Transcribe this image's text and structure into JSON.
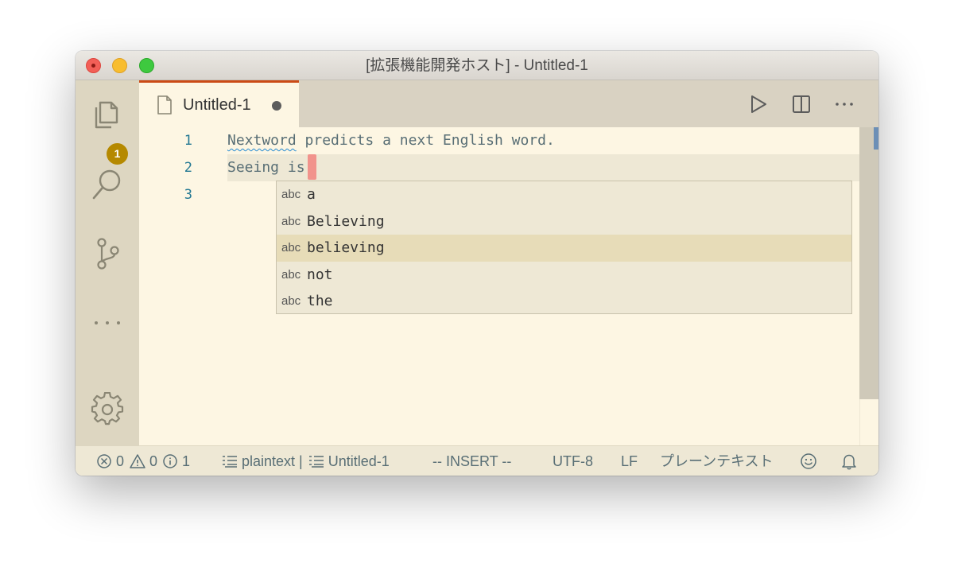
{
  "window": {
    "title": "[拡張機能開発ホスト] - Untitled-1"
  },
  "activity_bar": {
    "items": [
      {
        "name": "explorer",
        "icon": "files-icon",
        "badge": "1"
      },
      {
        "name": "search",
        "icon": "search-icon"
      },
      {
        "name": "source-control",
        "icon": "git-branch-icon"
      },
      {
        "name": "more",
        "icon": "more-horizontal-icon"
      },
      {
        "name": "manage",
        "icon": "gear-icon"
      }
    ]
  },
  "tabs": [
    {
      "label": "Untitled-1",
      "icon": "file-icon",
      "dirty": true
    }
  ],
  "tab_actions": [
    {
      "icon": "run-icon"
    },
    {
      "icon": "split-editor-icon"
    },
    {
      "icon": "more-actions-icon"
    }
  ],
  "editor": {
    "lines": [
      {
        "number": "1",
        "prefix": "Nextword",
        "rest": " predicts a next English word."
      },
      {
        "number": "2",
        "text": "Seeing is"
      },
      {
        "number": "3",
        "text": ""
      }
    ]
  },
  "suggest_widget": {
    "items": [
      {
        "kind": "abc",
        "label": "a",
        "selected": false
      },
      {
        "kind": "abc",
        "label": "Believing",
        "selected": false
      },
      {
        "kind": "abc",
        "label": "believing",
        "selected": true
      },
      {
        "kind": "abc",
        "label": "not",
        "selected": false
      },
      {
        "kind": "abc",
        "label": "the",
        "selected": false
      }
    ]
  },
  "status_bar": {
    "errors": "0",
    "warnings": "0",
    "infos": "1",
    "language_mode": "plaintext | ",
    "file_name": "Untitled-1",
    "vim_mode": "-- INSERT --",
    "encoding": "UTF-8",
    "eol": "LF",
    "language": "プレーンテキスト"
  },
  "colors": {
    "accent": "#cb4b16",
    "badge": "#b58900",
    "editor_background": "#fdf6e3",
    "line_numbers": "#237893",
    "cursor": "#f1938c"
  }
}
